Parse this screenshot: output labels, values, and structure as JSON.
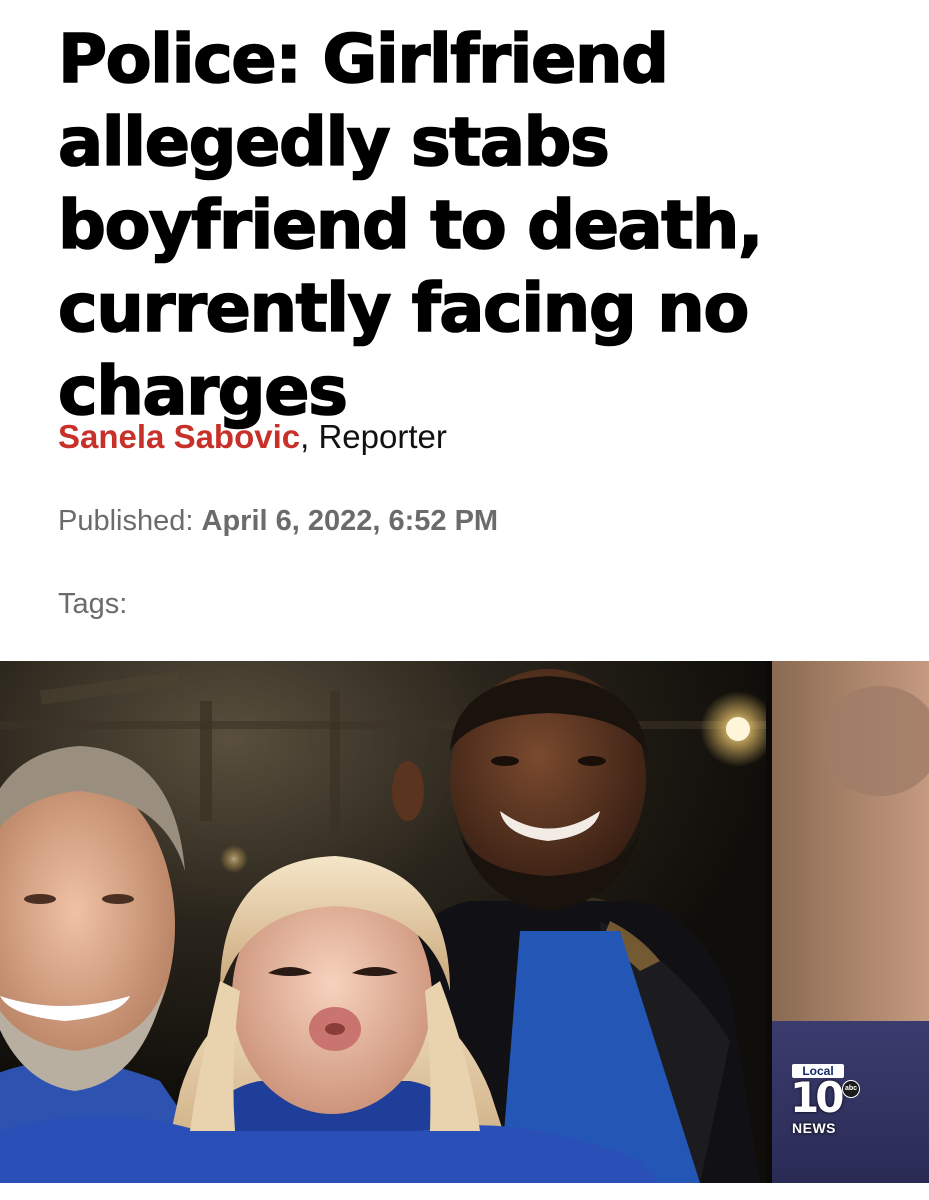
{
  "article": {
    "headline": "Police: Girlfriend allegedly stabs boyfriend to death, currently facing no charges",
    "author_name": "Sanela Sabovic",
    "author_role": ", Reporter",
    "published_label": "Published: ",
    "published_date": "April 6, 2022, 6:52 PM",
    "tags_label": "Tags:"
  },
  "photo": {
    "watermark": {
      "top_label": "Local",
      "number": "10",
      "network": "abc",
      "bottom_label": "NEWS"
    }
  },
  "colors": {
    "headline": "#000000",
    "author": "#c8302a",
    "meta": "#6b6b6b"
  }
}
